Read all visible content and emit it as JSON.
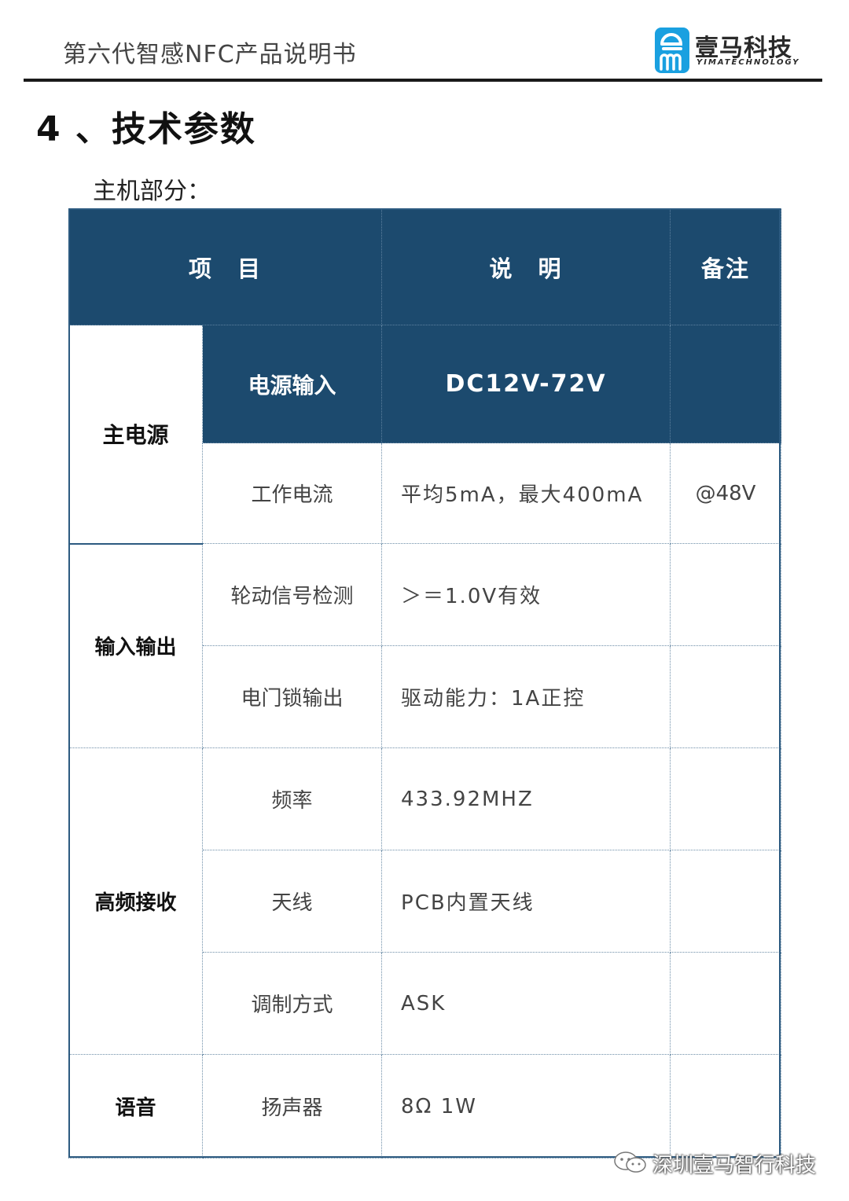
{
  "header": {
    "doc_title": "第六代智感NFC产品说明书",
    "logo_cn": "壹马科技",
    "logo_en": "YIMATECHNOLOGY"
  },
  "section": {
    "title": "4 、技术参数",
    "subtitle": "主机部分："
  },
  "table": {
    "headers": {
      "item": "项　目",
      "desc": "说　明",
      "note": "备注"
    },
    "groups": {
      "power": "主电源",
      "io": "输入输出",
      "rf": "高频接收",
      "voice": "语音"
    },
    "rows": [
      {
        "item": "电源输入",
        "desc": "DC12V-72V",
        "note": ""
      },
      {
        "item": "工作电流",
        "desc": "平均5mA，最大400mA",
        "note": "@48V"
      },
      {
        "item": "轮动信号检测",
        "desc": "＞＝1.0V有效",
        "note": ""
      },
      {
        "item": "电门锁输出",
        "desc": "驱动能力：1A正控",
        "note": ""
      },
      {
        "item": "频率",
        "desc": "433.92MHZ",
        "note": ""
      },
      {
        "item": "天线",
        "desc": "PCB内置天线",
        "note": ""
      },
      {
        "item": "调制方式",
        "desc": "ASK",
        "note": ""
      },
      {
        "item": "扬声器",
        "desc": "8Ω 1W",
        "note": ""
      }
    ]
  },
  "watermark": {
    "text": "深圳壹马智行科技"
  },
  "colors": {
    "table_header": "#1c4a6e",
    "rule": "#1a1a1a"
  }
}
